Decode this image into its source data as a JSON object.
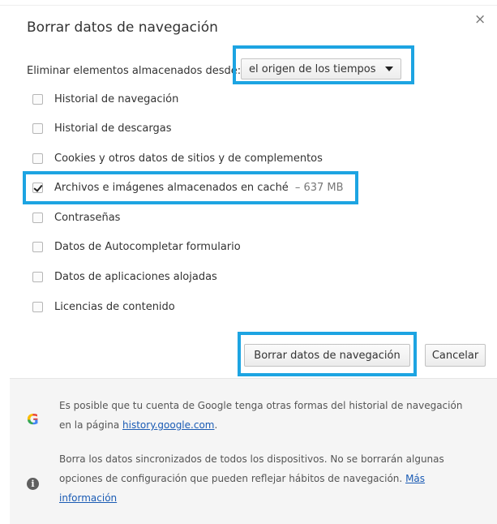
{
  "dialog": {
    "title": "Borrar datos de navegación",
    "close_glyph": "×"
  },
  "range": {
    "label": "Eliminar elementos almacenados desde:",
    "selected": "el origen de los tiempos"
  },
  "options": [
    {
      "label": "Historial de navegación",
      "checked": false
    },
    {
      "label": "Historial de descargas",
      "checked": false
    },
    {
      "label": "Cookies y otros datos de sitios y de complementos",
      "checked": false
    },
    {
      "label": "Archivos e imágenes almacenados en caché",
      "size": "– 637 MB",
      "checked": true
    },
    {
      "label": "Contraseñas",
      "checked": false
    },
    {
      "label": "Datos de Autocompletar formulario",
      "checked": false
    },
    {
      "label": "Datos de aplicaciones alojadas",
      "checked": false
    },
    {
      "label": "Licencias de contenido",
      "checked": false
    }
  ],
  "buttons": {
    "clear": "Borrar datos de navegación",
    "cancel": "Cancelar"
  },
  "footer": {
    "google_text": "Es posible que tu cuenta de Google tenga otras formas del historial de navegación en la página",
    "google_link": "history.google.com",
    "google_end": ".",
    "sync_text": "Borra los datos sincronizados de todos los dispositivos. No se borrarán algunas opciones de configuración que pueden reflejar hábitos de navegación.",
    "sync_link": "Más información",
    "g_letter": "G",
    "info_glyph": "i"
  },
  "colors": {
    "highlight": "#1da4e2",
    "link": "#1a5bb4"
  },
  "icons": [
    "close-icon",
    "chevron-down-icon",
    "google-g-icon",
    "info-icon",
    "checkmark-icon"
  ]
}
